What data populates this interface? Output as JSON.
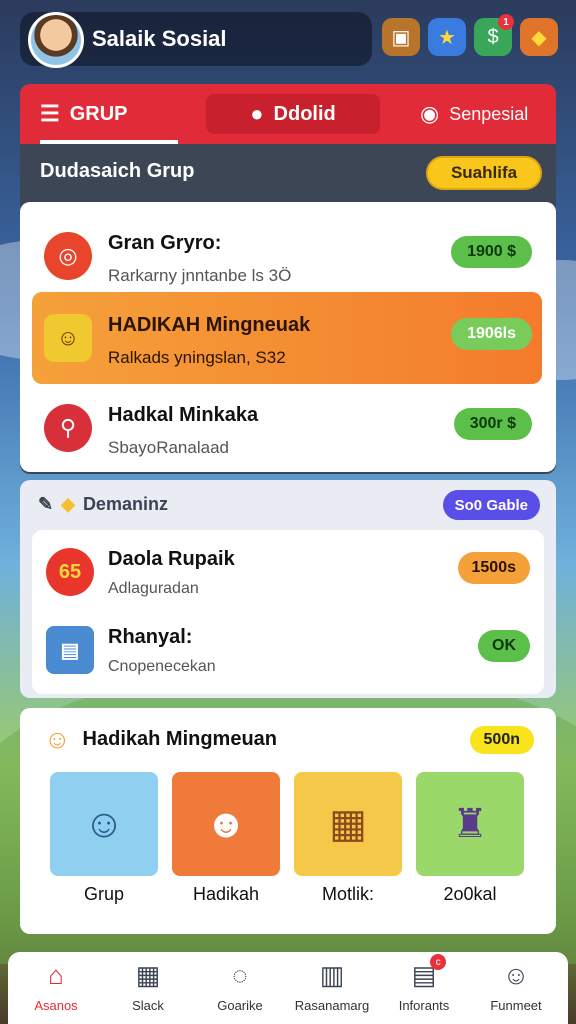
{
  "header": {
    "profile_name": "Salaik Sosial"
  },
  "top_icons": [
    {
      "name": "chest-icon",
      "glyph": "▣",
      "bg": "#b8742a"
    },
    {
      "name": "trophy-icon",
      "glyph": "★",
      "bg": "#3a7be0"
    },
    {
      "name": "money-icon",
      "glyph": "$",
      "bg": "#3aa65a",
      "badge": "1"
    },
    {
      "name": "gift-icon",
      "glyph": "◆",
      "bg": "#e0742a"
    }
  ],
  "tabs": [
    {
      "label": "GRUP",
      "icon": "☰"
    },
    {
      "label": "Ddolid",
      "icon": "●"
    },
    {
      "label": "Senpesial",
      "icon": "◉"
    }
  ],
  "group_section": {
    "title": "Dudasaich Grup",
    "button": "Suahlifa",
    "items": [
      {
        "title": "Gran Gryro:",
        "subtitle": "Rarkarny jnntanbe ls 3Ö",
        "badge": "1900 $",
        "icon_color": "#e8452c",
        "badge_bg": "#5cbf4a"
      },
      {
        "title": "HADIKAH Mingneuak",
        "subtitle": "Ralkads yningslan, S32",
        "badge": "1906ls",
        "icon_color": "#f0c830",
        "badge_bg": "#7acc5a"
      },
      {
        "title": "Hadkal Minkaka",
        "subtitle": "SbayoRanalaad",
        "badge": "300r $",
        "icon_color": "#d8303a",
        "badge_bg": "#5cbf4a"
      }
    ]
  },
  "demand_section": {
    "title": "Demaninz",
    "tag": "So0 Gable",
    "items": [
      {
        "title": "Daola Rupaik",
        "subtitle": "Adlaguradan",
        "badge": "1500s",
        "icon_color": "#e8362c",
        "badge_bg": "#f5a13a",
        "icon_text": "65"
      },
      {
        "title": "Rhanyal:",
        "subtitle": "Cnopenecekan",
        "badge": "OK",
        "icon_color": "#4a8ad0",
        "badge_bg": "#5cbf4a",
        "icon_text": "▤"
      }
    ]
  },
  "gift_section": {
    "title": "Hadikah Mingmeuan",
    "badge": "500n",
    "tiles": [
      {
        "label": "Grup",
        "bg": "#8fd0f0",
        "glyph": "☺"
      },
      {
        "label": "Hadikah",
        "bg": "#f07a3a",
        "glyph": "☻"
      },
      {
        "label": "Motlik:",
        "bg": "#f5c84a",
        "glyph": "▦"
      },
      {
        "label": "2o0kal",
        "bg": "#9ad86a",
        "glyph": "♜"
      }
    ]
  },
  "bottom_nav": [
    {
      "label": "Asanos",
      "icon": "⌂",
      "active": true
    },
    {
      "label": "Slack",
      "icon": "▦",
      "active": false
    },
    {
      "label": "Goarike",
      "icon": "◌",
      "active": false
    },
    {
      "label": "Rasanamarg",
      "icon": "▥",
      "active": false
    },
    {
      "label": "Inforants",
      "icon": "▤",
      "active": false,
      "badge": "c"
    },
    {
      "label": "Funmeet",
      "icon": "☺",
      "active": false
    }
  ]
}
